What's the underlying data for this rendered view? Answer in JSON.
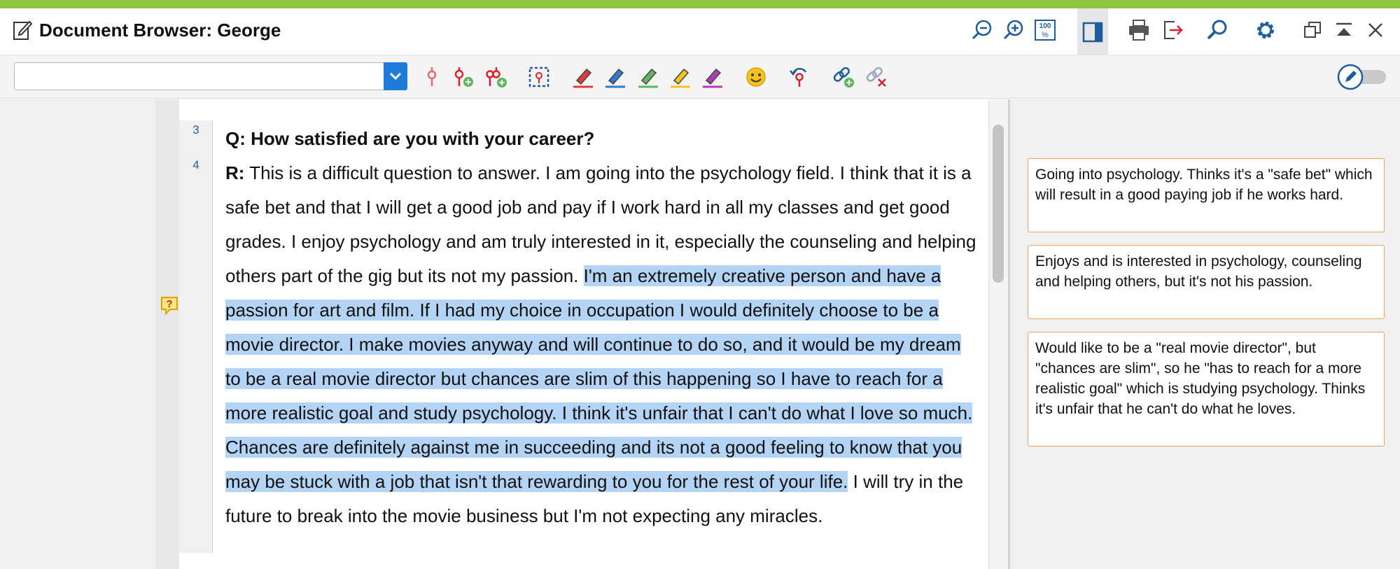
{
  "window": {
    "title": "Document Browser: George"
  },
  "toolbar": {
    "code_combo_value": ""
  },
  "colors": {
    "accent_bar": "#8cc63f",
    "highlight": "#b3d4f5",
    "memo_border": "#f0a35b",
    "combo_button": "#1e7bd9"
  },
  "icons": {
    "title": "edit-document-icon",
    "window_buttons": [
      "zoom-out-icon",
      "zoom-in-icon",
      "zoom-100-icon",
      "side-panel-icon",
      "print-icon",
      "export-icon",
      "search-icon",
      "settings-gear-icon",
      "restore-window-icon",
      "collapse-up-icon",
      "close-icon"
    ],
    "tools": [
      "code-icon",
      "code-add-icon",
      "code-add-multi-icon",
      "select-area-icon",
      "highlighter-red-icon",
      "highlighter-blue-icon",
      "highlighter-green-icon",
      "highlighter-yellow-icon",
      "highlighter-purple-icon",
      "emoticode-smiley-icon",
      "recode-icon",
      "link-add-icon",
      "link-remove-icon"
    ]
  },
  "document": {
    "lines": [
      {
        "number": "3"
      },
      {
        "number": "4"
      }
    ],
    "question_label": "Q:",
    "question_text": " How satisfied are you with your career?",
    "response_label": "R:",
    "response_before": " This is a difficult question to answer. I am going into the psychology field. I think that it is a safe bet and that I will get a good job and pay if I work hard in all my classes and get good grades. I enjoy psychology and am truly interested in it, especially the counseling and helping others part of the gig but its not my passion. ",
    "response_highlighted": "I'm an extremely creative person and have a passion for art and film. If I had my choice in occupation I would definitely choose to be a movie director. I make movies anyway and will continue to do so, and it would be my dream to be a real movie director but chances are slim of this happening so I have to reach for a more realistic goal and study psychology. I think it's unfair that I can't do what I love so much. Chances are definitely against me in succeeding and its not a good feeling to know that you may be stuck with a job that isn't that rewarding to you for the rest of your life.",
    "response_after": " I will try in the future to break into the movie business but I'm not expecting any miracles."
  },
  "memos": [
    {
      "text": "Going into psychology. Thinks it's a \"safe bet\" which will result in a good paying job if he works hard."
    },
    {
      "text": "Enjoys and is interested in psychology, counseling and helping others, but it's not his passion."
    },
    {
      "text": "Would like to be a \"real movie director\", but \"chances are slim\", so he \"has to reach for a more realistic goal\" which is studying psychology. Thinks it's unfair that he can't do what he loves."
    }
  ]
}
